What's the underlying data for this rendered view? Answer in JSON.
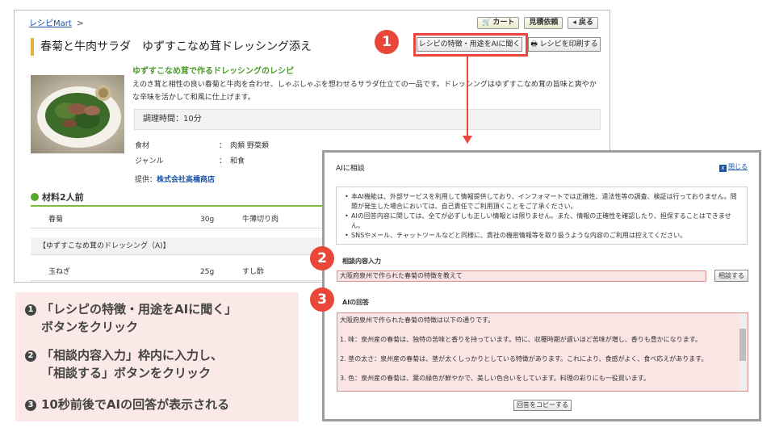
{
  "breadcrumb": {
    "link": "レシピMart",
    "sep": ">"
  },
  "toolbar": {
    "cart": "カート",
    "estimate": "見積依頼",
    "back": "◂ 戻る"
  },
  "recipe": {
    "title": "春菊と牛肉サラダ",
    "subtitle": "ゆずすこなめ茸ドレッシング添え",
    "ai_button": "レシピの特徴・用途をAIに聞く",
    "print_button": "レシピを印刷する",
    "catchphrase": "ゆずすこなめ茸で作るドレッシングのレシピ",
    "description": "えのき茸と相性の良い春菊と牛肉を合わせ、しゃぶしゃぶを想わせるサラダ仕立ての一品です。ドレッシングはゆずすこなめ茸の旨味と爽やかな辛味を活かして和風に仕上げます。",
    "cook_time": "調理時間：10分",
    "info": [
      {
        "key": "食材",
        "colon": "：",
        "value": "肉類 野菜類"
      },
      {
        "key": "ジャンル",
        "colon": "：",
        "value": "和食"
      }
    ],
    "provider_label": "提供：",
    "provider_name": "株式会社高橋商店",
    "ingredients_heading": "材料2人前",
    "ingredients": [
      {
        "name": "春菊",
        "amount": "30g",
        "name2": "牛薄切り肉"
      },
      {
        "group": "【ゆずすこなめ茸のドレッシング（A)】"
      },
      {
        "name": "玉ねぎ",
        "amount": "25g",
        "name2": "すし酢"
      }
    ]
  },
  "callouts": {
    "one": "1",
    "two": "2",
    "three": "3"
  },
  "steps": [
    {
      "num": "1",
      "line1": "「レシピの特徴・用途をAIに聞く」",
      "line2": "ボタンをクリック"
    },
    {
      "num": "2",
      "line1": "「相談内容入力」枠内に入力し、",
      "line2": "「相談する」ボタンをクリック"
    },
    {
      "num": "3",
      "line1": "10秒前後でAIの回答が表示される",
      "line2": ""
    }
  ],
  "dialog": {
    "title": "AIに相談",
    "close": "閉じる",
    "close_icon": "x",
    "notices": [
      "本AI機能は、外部サービスを利用して情報提供しており、インフォマートでは正確性、違法性等の調査、検証は行っておりません。問題が発生した場合においては、自己責任でご利用頂くことをご了承ください。",
      "AIの回答内容に関しては、全てが必ずしも正しい情報とは限りません。また、情報の正確性を確認したり、担保することはできません。",
      "SNSやメール、チャットツールなどと同様に、貴社の機密情報等を取り扱うような内容のご利用は控えてください。"
    ],
    "input_label": "相談内容入力",
    "input_value": "大阪府泉州で作られた春菊の特徴を教えて",
    "ask_button": "相談する",
    "answer_label": "AIの回答",
    "answer": [
      "大阪府泉州で作られた春菊の特徴は以下の通りです。",
      "1. 味：泉州産の春菊は、独特の苦味と香りを持っています。特に、収穫時期が遅いほど苦味が増し、香りも豊かになります。",
      "2. 茎の太さ：泉州産の春菊は、茎が太くしっかりとしている特徴があります。これにより、食感がよく、食べ応えがあります。",
      "3. 色：泉州産の春菊は、葉の緑色が鮮やかで、美しい色合いをしています。料理の彩りにも一役買います。"
    ],
    "copy_button": "回答をコピーする"
  },
  "colors": {
    "accent_red": "#e8473a",
    "green": "#5aa52d",
    "pink": "#fbe9e7"
  }
}
